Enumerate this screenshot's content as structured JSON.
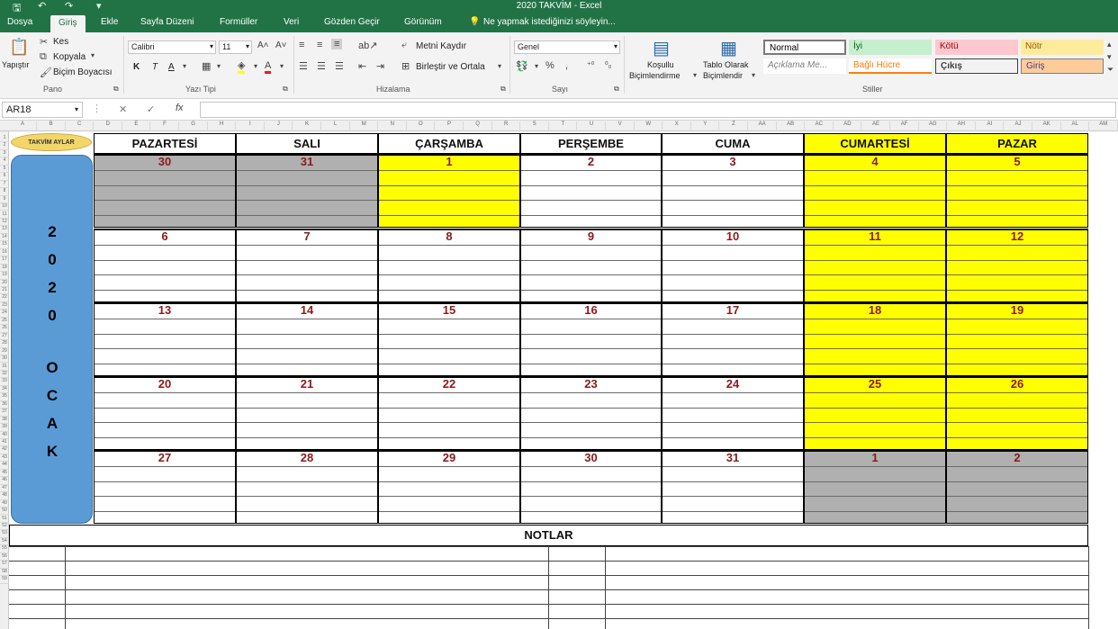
{
  "window": {
    "title": "2020 TAKVİM - Excel"
  },
  "tabs": [
    "Dosya",
    "Giriş",
    "Ekle",
    "Sayfa Düzeni",
    "Formüller",
    "Veri",
    "Gözden Geçir",
    "Görünüm"
  ],
  "tell_me": "Ne yapmak istediğinizi söyleyin...",
  "ribbon": {
    "paste": "Yapıştır",
    "cut": "Kes",
    "copy": "Kopyala",
    "format_painter": "Biçim Boyacısı",
    "font_name": "Calibri",
    "font_size": "11",
    "bold": "K",
    "italic": "T",
    "underline": "A",
    "wrap_text": "Metni Kaydır",
    "merge_center": "Birleştir ve Ortala",
    "number_format": "Genel",
    "conditional_1": "Koşullu",
    "conditional_2": "Biçimlendirme",
    "table_1": "Tablo Olarak",
    "table_2": "Biçimlendir",
    "groups": {
      "pano": "Pano",
      "yazi_tipi": "Yazı Tipi",
      "hizalama": "Hizalama",
      "sayi": "Sayı",
      "stiller": "Stiller"
    },
    "styles": [
      "Normal",
      "İyi",
      "Kötü",
      "Nötr",
      "Açıklama Me...",
      "Bağlı Hücre",
      "Çıkış",
      "Giriş"
    ]
  },
  "formula_bar": {
    "name_box": "AR18",
    "fx": "fx",
    "cancel": "✕",
    "enter": "✓",
    "value": ""
  },
  "sheet": {
    "col_letters": [
      "A",
      "B",
      "C",
      "D",
      "E",
      "F",
      "G",
      "H",
      "I",
      "J",
      "K",
      "L",
      "M",
      "N",
      "O",
      "P",
      "Q",
      "R",
      "S",
      "T",
      "U",
      "V",
      "W",
      "X",
      "Y",
      "Z",
      "AA",
      "AB",
      "AC",
      "AD",
      "AE",
      "AF",
      "AG",
      "AH",
      "AI",
      "AJ",
      "AK",
      "AL",
      "AM"
    ],
    "row_numbers": [
      "1",
      "2",
      "3",
      "4",
      "5",
      "6",
      "7",
      "8",
      "9",
      "10",
      "11",
      "12",
      "13",
      "14",
      "15",
      "16",
      "17",
      "18",
      "19",
      "20",
      "21",
      "22",
      "23",
      "24",
      "25",
      "26",
      "27",
      "28",
      "29",
      "30",
      "31",
      "32",
      "33",
      "34",
      "35",
      "36",
      "37",
      "38",
      "39",
      "40",
      "41",
      "42",
      "43",
      "44",
      "45",
      "46",
      "47",
      "48",
      "49",
      "50",
      "51",
      "52",
      "53",
      "54",
      "55",
      "56",
      "57",
      "58",
      "59"
    ]
  },
  "calendar": {
    "badge": "TAKVİM AYLAR",
    "year_month_letters": [
      "2",
      "0",
      "2",
      "0",
      "O",
      "C",
      "A",
      "K"
    ],
    "days": [
      "PAZARTESİ",
      "SALI",
      "ÇARŞAMBA",
      "PERŞEMBE",
      "CUMA",
      "CUMARTESİ",
      "PAZAR"
    ],
    "weeks": [
      [
        "30",
        "31",
        "1",
        "2",
        "3",
        "4",
        "5"
      ],
      [
        "6",
        "7",
        "8",
        "9",
        "10",
        "11",
        "12"
      ],
      [
        "13",
        "14",
        "15",
        "16",
        "17",
        "18",
        "19"
      ],
      [
        "20",
        "21",
        "22",
        "23",
        "24",
        "25",
        "26"
      ],
      [
        "27",
        "28",
        "29",
        "30",
        "31",
        "1",
        "2"
      ]
    ],
    "notes_title": "NOTLAR"
  },
  "colors": {
    "excel_green": "#217346",
    "weekend": "#ffff00",
    "inactive": "#b0b0b0",
    "badge": "#f3d66a",
    "side_panel": "#5b9bd5",
    "day_number": "#8b1a1a"
  }
}
